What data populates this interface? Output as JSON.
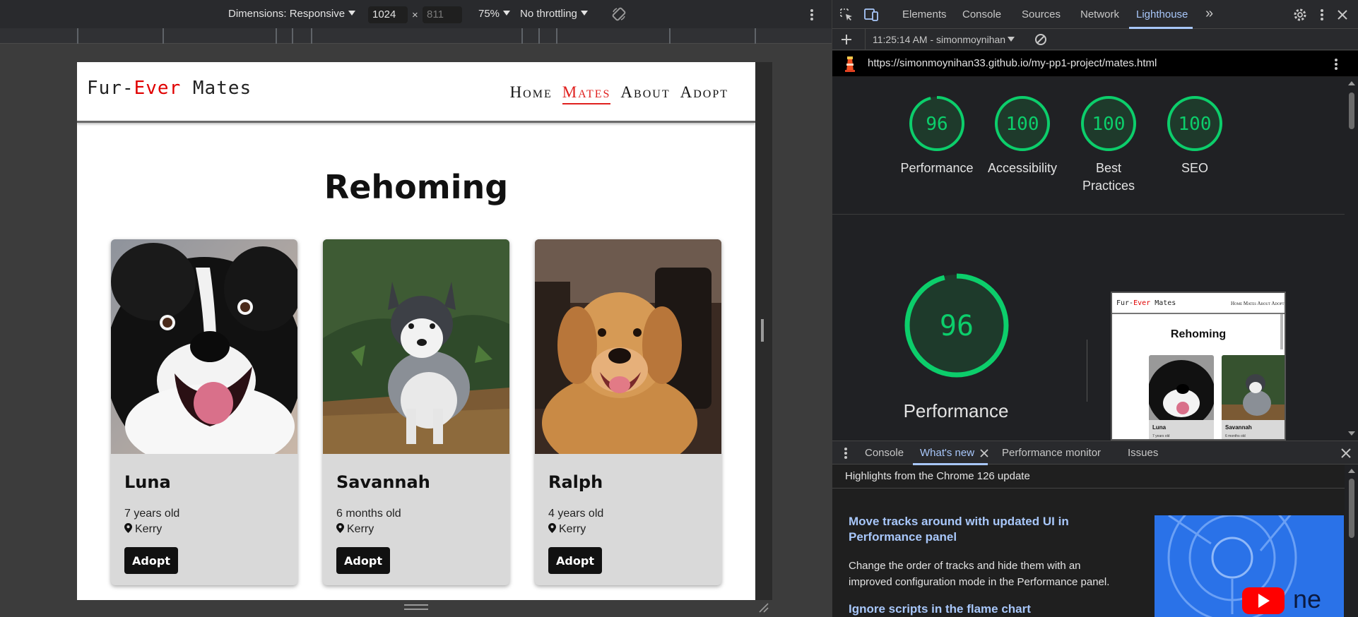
{
  "device_toolbar": {
    "dimensions_label": "Dimensions: Responsive",
    "width_value": "1024",
    "times": "×",
    "height_value": "811",
    "zoom": "75%",
    "throttling": "No throttling"
  },
  "site": {
    "logo_pre": "Fur-",
    "logo_mid": "Ever",
    "logo_post": " Mates",
    "nav": [
      "Home",
      "Mates",
      "About",
      "Adopt"
    ],
    "active_nav": "Mates",
    "heading": "Rehoming",
    "cards": [
      {
        "name": "Luna",
        "age": "7 years old",
        "location": "Kerry",
        "button": "Adopt"
      },
      {
        "name": "Savannah",
        "age": "6 months old",
        "location": "Kerry",
        "button": "Adopt"
      },
      {
        "name": "Ralph",
        "age": "4 years old",
        "location": "Kerry",
        "button": "Adopt"
      }
    ]
  },
  "devtools": {
    "tabs": [
      "Elements",
      "Console",
      "Sources",
      "Network",
      "Lighthouse"
    ],
    "active_tab": "Lighthouse",
    "overflow": "»",
    "report_selector": "11:25:14 AM - simonmoynihan",
    "url": "https://simonmoynihan33.github.io/my-pp1-project/mates.html",
    "scores": [
      {
        "label": "Performance",
        "value": 96
      },
      {
        "label": "Accessibility",
        "value": 100
      },
      {
        "label": "Best Practices",
        "value": 100
      },
      {
        "label": "SEO",
        "value": 100
      }
    ],
    "big_score": {
      "label": "Performance",
      "value": 96
    },
    "thumbnail": {
      "logo_pre": "Fur-",
      "logo_mid": "Ever",
      "logo_post": " Mates",
      "nav": "Home Mates About Adopt",
      "heading": "Rehoming",
      "cards": [
        {
          "name": "Luna",
          "age": "7 years old"
        },
        {
          "name": "Savannah",
          "age": "6 months old"
        }
      ]
    },
    "score_color": "#0cce6b",
    "drawer": {
      "tabs": [
        "Console",
        "What's new",
        "Performance monitor",
        "Issues"
      ],
      "active_tab": "What's new",
      "subtitle": "Highlights from the Chrome 126 update",
      "items": [
        {
          "title": "Move tracks around with updated UI in Performance panel",
          "body": "Change the order of tracks and hide them with an improved configuration mode in the Performance panel."
        },
        {
          "title": "Ignore scripts in the flame chart"
        }
      ],
      "promo_text": "ne"
    }
  }
}
